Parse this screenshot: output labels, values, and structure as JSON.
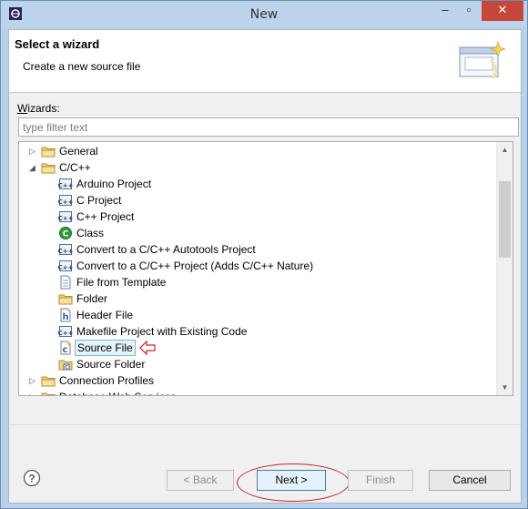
{
  "window": {
    "title": "New",
    "minimize": "–",
    "maximize": "▫",
    "close": "✕"
  },
  "banner": {
    "title": "Select a wizard",
    "description": "Create a new source file"
  },
  "wizards": {
    "label_prefix": "W",
    "label_rest": "izards:",
    "filter_placeholder": "type filter text"
  },
  "tree": {
    "items": [
      {
        "label": "General",
        "kind": "folder",
        "expanded": false
      },
      {
        "label": "C/C++",
        "kind": "folder",
        "expanded": true
      },
      {
        "label": "Arduino Project",
        "kind": "cpp-project"
      },
      {
        "label": "C Project",
        "kind": "cpp-project"
      },
      {
        "label": "C++ Project",
        "kind": "cpp-project"
      },
      {
        "label": "Class",
        "kind": "class"
      },
      {
        "label": "Convert to a C/C++ Autotools Project",
        "kind": "cpp-project"
      },
      {
        "label": "Convert to a C/C++ Project (Adds C/C++ Nature)",
        "kind": "cpp-project"
      },
      {
        "label": "File from Template",
        "kind": "file"
      },
      {
        "label": "Folder",
        "kind": "plain-folder"
      },
      {
        "label": "Header File",
        "kind": "header"
      },
      {
        "label": "Makefile Project with Existing Code",
        "kind": "cpp-project"
      },
      {
        "label": "Source File",
        "kind": "source",
        "selected": true
      },
      {
        "label": "Source Folder",
        "kind": "source-folder"
      },
      {
        "label": "Connection Profiles",
        "kind": "folder",
        "expanded": false
      },
      {
        "label": "Database Web Services",
        "kind": "folder",
        "expanded": false
      }
    ]
  },
  "buttons": {
    "help": "?",
    "back": "< Back",
    "next": "Next >",
    "finish": "Finish",
    "cancel": "Cancel"
  }
}
